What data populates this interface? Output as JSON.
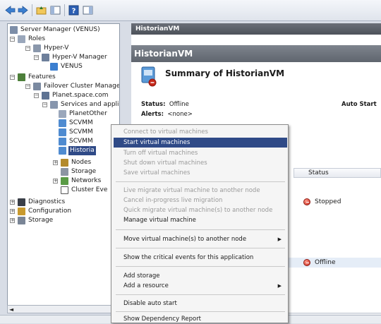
{
  "toolbar": {
    "buttons": [
      "back-arrow-icon",
      "forward-arrow-icon",
      "up-folder-icon",
      "show-hide-tree-icon",
      "help-icon",
      "show-action-pane-icon"
    ]
  },
  "tree": {
    "items": [
      {
        "label": "Server Manager (VENUS)",
        "icon": "server-manager-icon"
      },
      {
        "label": "Roles",
        "icon": "roles-icon"
      },
      {
        "label": "Hyper-V",
        "icon": "hyper-v-icon"
      },
      {
        "label": "Hyper-V Manager",
        "icon": "hyper-v-manager-icon"
      },
      {
        "label": "VENUS",
        "icon": "server-icon"
      },
      {
        "label": "Features",
        "icon": "features-icon"
      },
      {
        "label": "Failover Cluster Manager",
        "icon": "cluster-manager-icon"
      },
      {
        "label": "Planet.space.com",
        "icon": "cluster-icon"
      },
      {
        "label": "Services and applic",
        "icon": "services-icon"
      },
      {
        "label": "PlanetOther",
        "icon": "app-icon"
      },
      {
        "label": "SCVMM",
        "icon": "vm-icon"
      },
      {
        "label": "SCVMM",
        "icon": "vm-icon"
      },
      {
        "label": "SCVMM",
        "icon": "vm-icon"
      },
      {
        "label": "Historia",
        "icon": "vm-icon"
      },
      {
        "label": "Nodes",
        "icon": "nodes-icon"
      },
      {
        "label": "Storage",
        "icon": "storage-icon"
      },
      {
        "label": "Networks",
        "icon": "networks-icon"
      },
      {
        "label": "Cluster Eve",
        "icon": "cluster-events-icon"
      },
      {
        "label": "Diagnostics",
        "icon": "diagnostics-icon"
      },
      {
        "label": "Configuration",
        "icon": "configuration-icon"
      },
      {
        "label": "Storage",
        "icon": "storage-icon"
      }
    ]
  },
  "right": {
    "header_title": "HistorianVM",
    "pane_title": "HistorianVM",
    "summary_title": "Summary of HistorianVM",
    "status_label": "Status:",
    "status_value": "Offline",
    "alerts_label": "Alerts:",
    "alerts_value": "<none>",
    "auto_start_label": "Auto Start",
    "column_status": "Status",
    "rows": [
      {
        "state": "Stopped"
      },
      {
        "state": "Offline"
      }
    ]
  },
  "context_menu": {
    "items": [
      {
        "label": "Connect to virtual machines",
        "disabled": true
      },
      {
        "label": "Start virtual machines",
        "highlighted": true
      },
      {
        "label": "Turn off virtual machines",
        "disabled": true
      },
      {
        "label": "Shut down virtual machines",
        "disabled": true
      },
      {
        "label": "Save virtual machines",
        "disabled": true
      },
      {
        "label": "Live migrate virtual machine to another node",
        "disabled": true
      },
      {
        "label": "Cancel in-progress live migration",
        "disabled": true
      },
      {
        "label": "Quick migrate virtual machine(s) to another node",
        "disabled": true
      },
      {
        "label": "Manage virtual machine"
      },
      {
        "label": "Move virtual machine(s) to another node",
        "submenu": true
      },
      {
        "label": "Show the critical events for this application"
      },
      {
        "label": "Add storage"
      },
      {
        "label": "Add a resource",
        "submenu": true
      },
      {
        "label": "Disable auto start"
      },
      {
        "label": "Show Dependency Report"
      }
    ]
  },
  "colors": {
    "highlight": "#2f4a87",
    "header_bar": "#5a5f67",
    "status_red": "#c7281b"
  }
}
